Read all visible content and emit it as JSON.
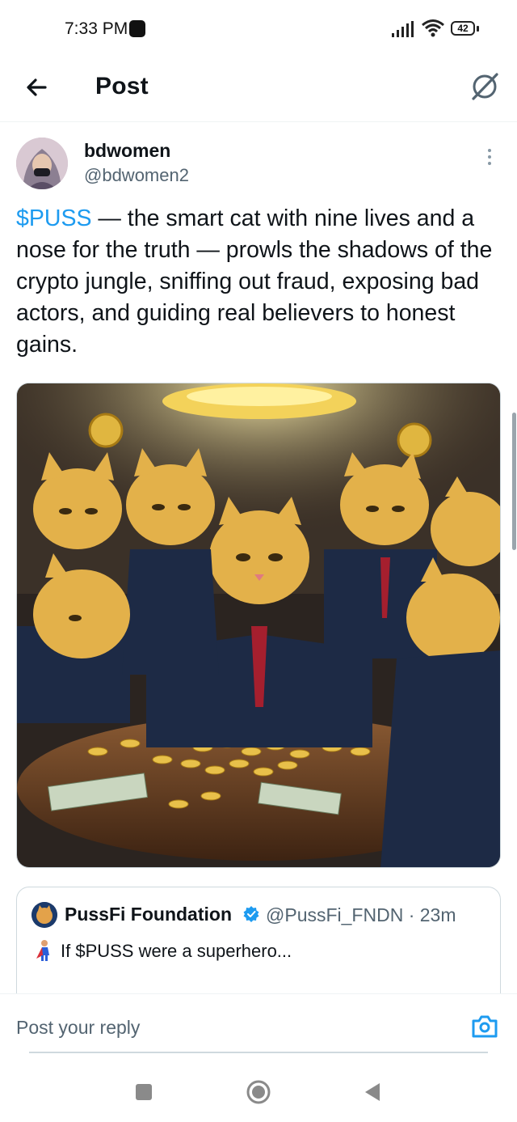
{
  "status_bar": {
    "time": "7:33 PM",
    "battery": "42",
    "icons": [
      "signal-icon",
      "wifi-icon",
      "battery-icon"
    ]
  },
  "header": {
    "title": "Post",
    "back_icon": "back-arrow-icon",
    "grok_icon": "grok-icon"
  },
  "post": {
    "author_name": "bdwomen",
    "author_handle": "@bdwomen2",
    "cashtag": "$PUSS",
    "text": " — the smart cat with nine lives and a nose for the truth — prowls the shadows of the crypto jungle, sniffing out fraud, exposing bad actors, and guiding real believers to honest gains.",
    "media": {
      "type": "image",
      "subject": "cats-in-suits-around-coin-table"
    }
  },
  "quote": {
    "author_name": "PussFi Foundation",
    "handle_time": "@PussFi_FNDN · 23m",
    "emoji": "superhero-emoji",
    "text": "If $PUSS were a superhero..."
  },
  "reply": {
    "placeholder": "Post your reply",
    "camera_icon": "camera-icon"
  },
  "colors": {
    "accent": "#1d9bf0",
    "text": "#0f1419",
    "secondary": "#536471",
    "border": "#cfd9de"
  }
}
